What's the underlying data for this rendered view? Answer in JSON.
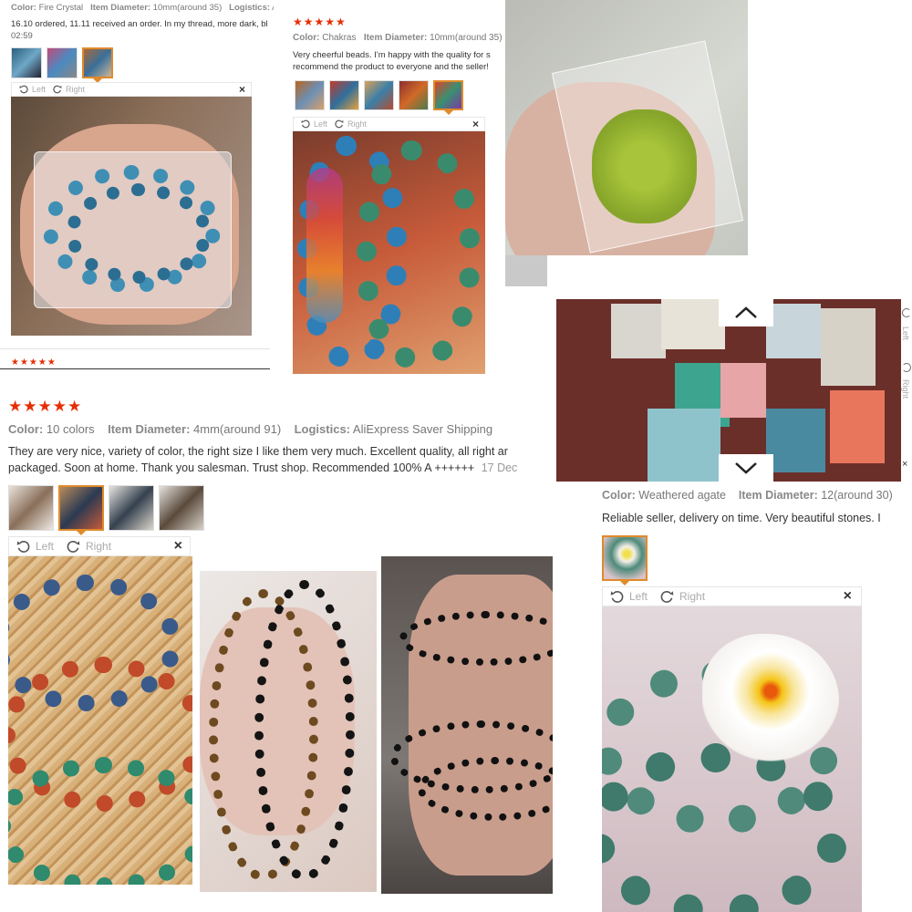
{
  "review1": {
    "color_label": "Color:",
    "color_value": "Fire Crystal",
    "diameter_label": "Item Diameter:",
    "diameter_value": "10mm(around 35)",
    "logistics_label": "Logistics:",
    "logistics_value": "Al",
    "text": "16.10 ordered, 11.11 received an order. In my thread, more dark, bl",
    "time": "02:59",
    "viewer": {
      "left": "Left",
      "right": "Right",
      "close": "×"
    },
    "next_stars": "★★★★★"
  },
  "review2": {
    "stars": "★★★★★",
    "color_label": "Color:",
    "color_value": "Chakras",
    "diameter_label": "Item Diameter:",
    "diameter_value": "10mm(around 35)",
    "text_line1": "Very cheerful beads. I'm happy with the quality for s",
    "text_line2": "recommend the product to everyone and the seller!",
    "viewer": {
      "left": "Left",
      "right": "Right",
      "close": "×"
    }
  },
  "review3": {
    "stars": "★★★★★",
    "color_label": "Color:",
    "color_value": "10 colors",
    "diameter_label": "Item Diameter:",
    "diameter_value": "4mm(around 91)",
    "logistics_label": "Logistics:",
    "logistics_value": "AliExpress Saver Shipping",
    "text_line1": "They are very nice, variety of color, the right size I like them very much. Excellent quality, all right ar",
    "text_line2": "packaged. Soon at home. Thank you salesman. Trust shop. Recommended 100% A ++++++",
    "date": "17 Dec",
    "viewer": {
      "left": "Left",
      "right": "Right",
      "close": "×"
    }
  },
  "review4": {
    "color_label": "Color:",
    "color_value": "Weathered agate",
    "diameter_label": "Item Diameter:",
    "diameter_value": "12(around 30)",
    "text": "Reliable seller, delivery on time. Very beautiful stones. I",
    "viewer": {
      "left": "Left",
      "right": "Right",
      "close": "×"
    },
    "side_left": "Left",
    "side_right": "Right",
    "side_close": "×"
  },
  "icons": {
    "rotate_left": "rotate-left-icon",
    "rotate_right": "rotate-right-icon",
    "close": "close-icon",
    "up": "chevron-up-icon",
    "down": "chevron-down-icon"
  },
  "colors": {
    "star": "#e62e04",
    "active_thumb": "#e08a2a",
    "label": "#888888"
  }
}
